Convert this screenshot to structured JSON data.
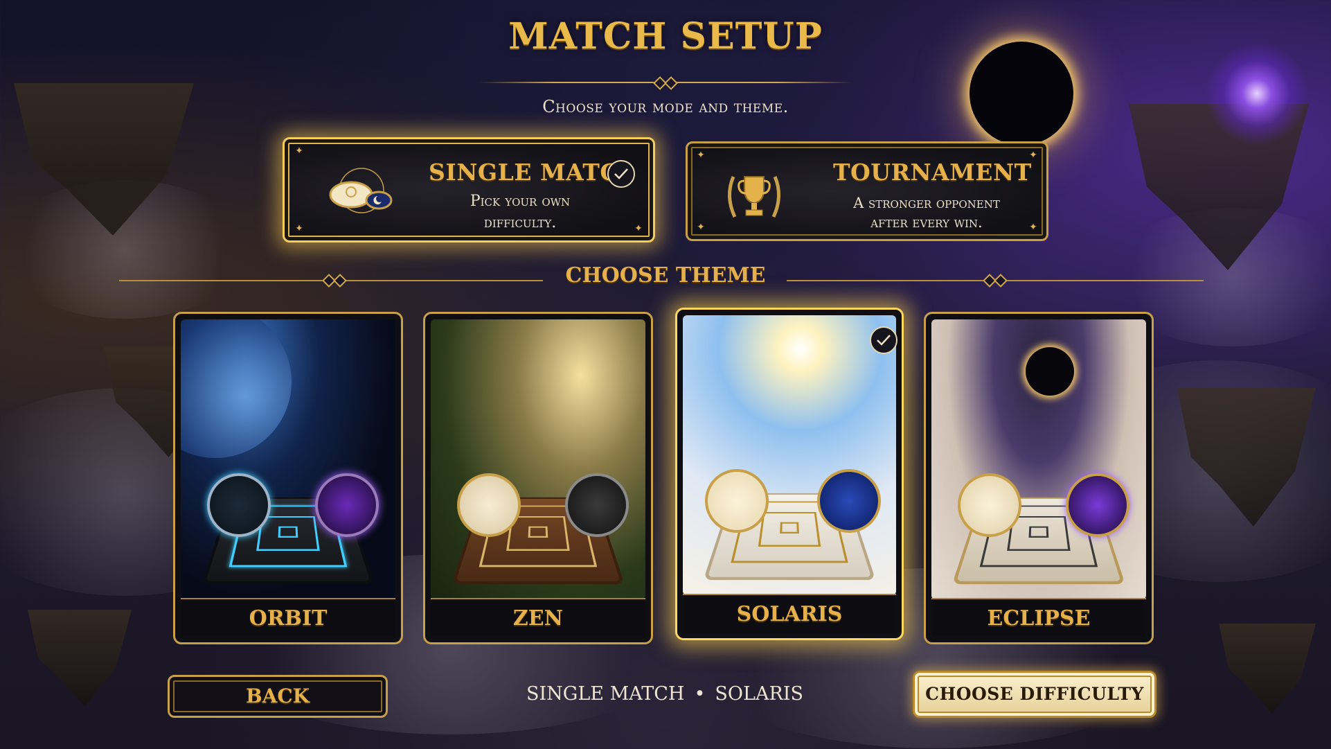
{
  "header": {
    "title": "MATCH SETUP",
    "subtitle": "Choose your mode and theme."
  },
  "modes": [
    {
      "title": "SINGLE MATCH",
      "description": "Pick your own difficulty.",
      "icon": "sun-moon-pieces-icon",
      "selected": true
    },
    {
      "title": "TOURNAMENT",
      "description": "A stronger opponent after every win.",
      "icon": "trophy-icon",
      "selected": false
    }
  ],
  "theme_section": {
    "label": "CHOOSE THEME"
  },
  "themes": [
    {
      "name": "ORBIT",
      "selected": false,
      "accent": "#3fd0ff"
    },
    {
      "name": "ZEN",
      "selected": false,
      "accent": "#d9b46a"
    },
    {
      "name": "SOLARIS",
      "selected": true,
      "accent": "#c9a04a"
    },
    {
      "name": "ECLIPSE",
      "selected": false,
      "accent": "#9a5cff"
    }
  ],
  "footer": {
    "back_label": "BACK",
    "summary_mode": "SINGLE MATCH",
    "summary_separator": "•",
    "summary_theme": "SOLARIS",
    "next_label": "CHOOSE DIFFICULTY"
  },
  "colors": {
    "gold": "#e6b04a",
    "selected_glow": "#ffd860",
    "cream_button": "#f4e4b8"
  }
}
